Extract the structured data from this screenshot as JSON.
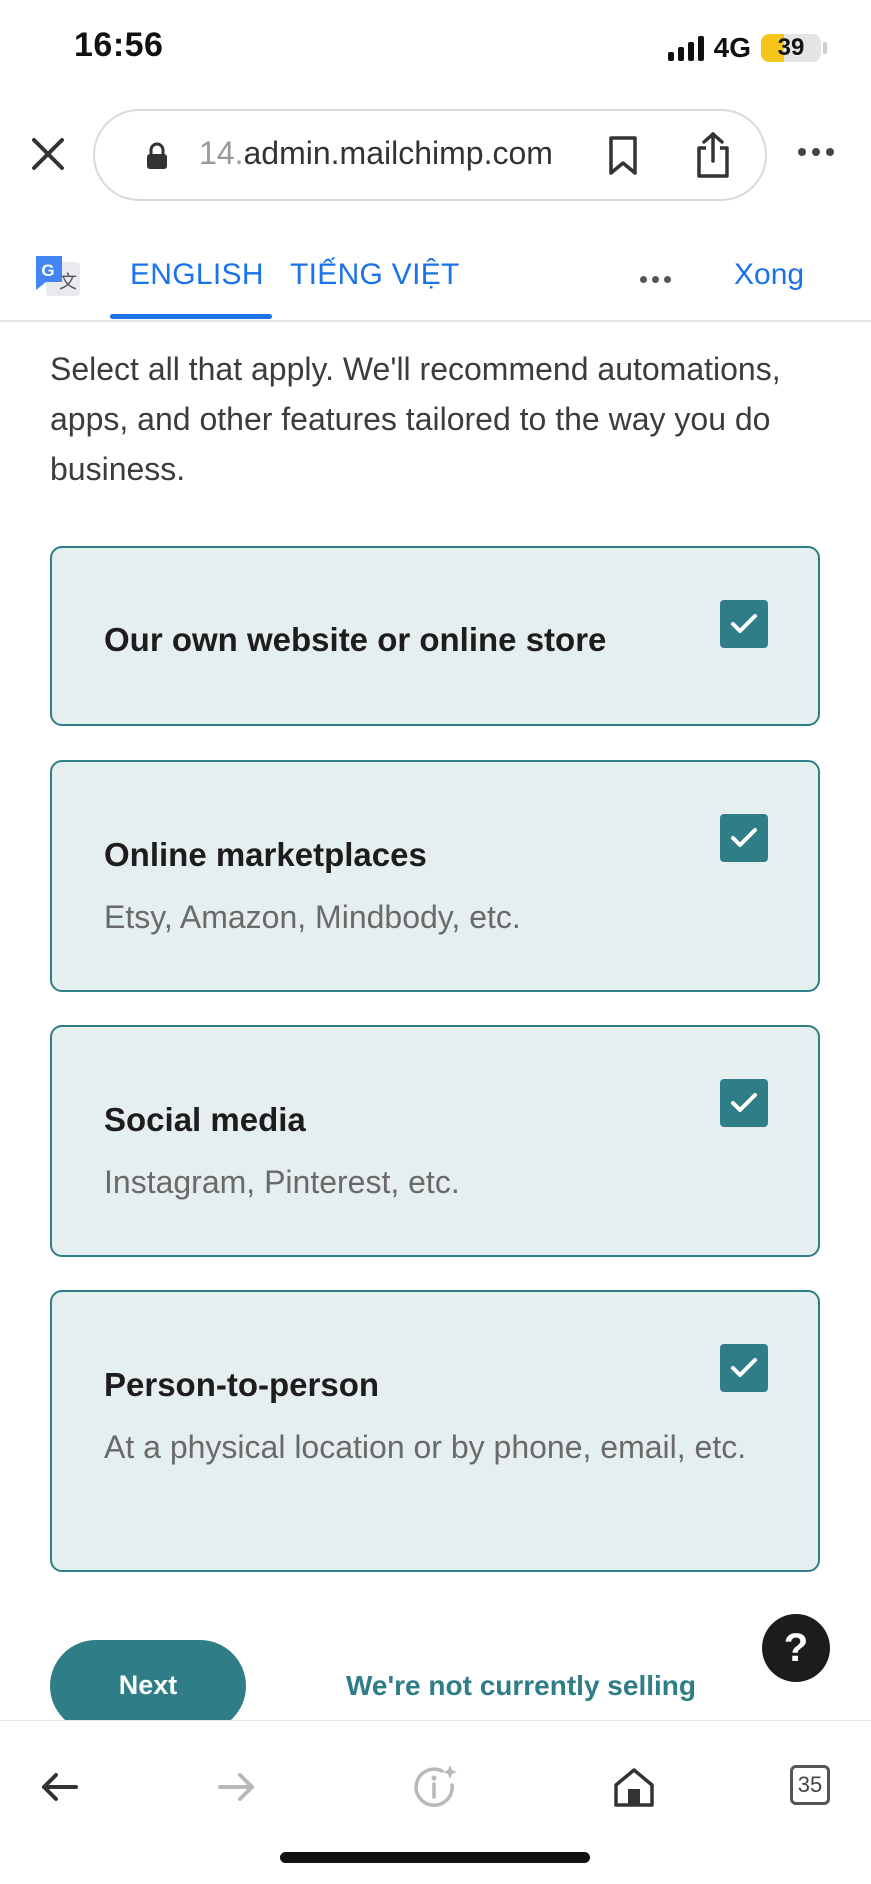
{
  "status_bar": {
    "time": "16:56",
    "network": "4G",
    "battery": "39",
    "battery_level": 0.39
  },
  "browser": {
    "url_prefix": "14.",
    "url_main": "admin.mailchimp.com"
  },
  "translate_bar": {
    "tab_english": "ENGLISH",
    "tab_vietnamese": "TIẾNG VIỆT",
    "done_label": "Xong"
  },
  "content": {
    "intro": "Select all that apply. We'll recommend automations, apps, and other features tailored to the way you do business.",
    "options": [
      {
        "title": "Our own website or online store",
        "subtitle": "",
        "checked": true
      },
      {
        "title": "Online marketplaces",
        "subtitle": "Etsy, Amazon, Mindbody, etc.",
        "checked": true
      },
      {
        "title": "Social media",
        "subtitle": "Instagram, Pinterest, etc.",
        "checked": true
      },
      {
        "title": "Person-to-person",
        "subtitle": "At a physical location or by phone, email, etc.",
        "checked": true
      }
    ],
    "next_label": "Next",
    "not_selling_label": "We're not currently selling",
    "help_label": "?"
  },
  "bottom_toolbar": {
    "tabs_count": "35"
  },
  "colors": {
    "accent": "#2f7d86",
    "card_bg": "#e6eff0",
    "link_blue": "#1a73e8"
  }
}
